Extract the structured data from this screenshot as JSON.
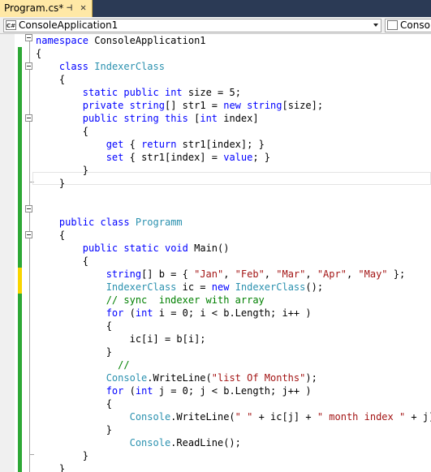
{
  "tab": {
    "title": "Program.cs*",
    "pin": "⊣",
    "close": "✕"
  },
  "nav": {
    "left_label": "ConsoleApplication1",
    "right_label": "Consol",
    "lang_icon": "C#"
  },
  "colors": {
    "keyword": "#0000ff",
    "type": "#2b91af",
    "string": "#a31515",
    "comment": "#008000",
    "tab_active": "#ffe8a6",
    "changed_saved": "#2ea836",
    "changed_unsaved": "#f9d500"
  },
  "code_lines": [
    [
      [
        "kw",
        "namespace"
      ],
      [
        "pl",
        " ConsoleApplication1"
      ]
    ],
    [
      [
        "pl",
        "{"
      ]
    ],
    [
      [
        "pl",
        "    "
      ],
      [
        "kw",
        "class"
      ],
      [
        "pl",
        " "
      ],
      [
        "ty",
        "IndexerClass"
      ]
    ],
    [
      [
        "pl",
        "    {"
      ]
    ],
    [
      [
        "pl",
        "        "
      ],
      [
        "kw",
        "static"
      ],
      [
        "pl",
        " "
      ],
      [
        "kw",
        "public"
      ],
      [
        "pl",
        " "
      ],
      [
        "kw",
        "int"
      ],
      [
        "pl",
        " size = 5;"
      ]
    ],
    [
      [
        "pl",
        "        "
      ],
      [
        "kw",
        "private"
      ],
      [
        "pl",
        " "
      ],
      [
        "kw",
        "string"
      ],
      [
        "pl",
        "[] str1 = "
      ],
      [
        "kw",
        "new"
      ],
      [
        "pl",
        " "
      ],
      [
        "kw",
        "string"
      ],
      [
        "pl",
        "[size];"
      ]
    ],
    [
      [
        "pl",
        "        "
      ],
      [
        "kw",
        "public"
      ],
      [
        "pl",
        " "
      ],
      [
        "kw",
        "string"
      ],
      [
        "pl",
        " "
      ],
      [
        "kw",
        "this"
      ],
      [
        "pl",
        " ["
      ],
      [
        "kw",
        "int"
      ],
      [
        "pl",
        " index]"
      ]
    ],
    [
      [
        "pl",
        "        {"
      ]
    ],
    [
      [
        "pl",
        "            "
      ],
      [
        "kw",
        "get"
      ],
      [
        "pl",
        " { "
      ],
      [
        "kw",
        "return"
      ],
      [
        "pl",
        " str1[index]; }"
      ]
    ],
    [
      [
        "pl",
        "            "
      ],
      [
        "kw",
        "set"
      ],
      [
        "pl",
        " { str1[index] = "
      ],
      [
        "kw",
        "value"
      ],
      [
        "pl",
        "; }"
      ]
    ],
    [
      [
        "pl",
        "        }"
      ]
    ],
    [
      [
        "pl",
        "    }"
      ]
    ],
    [
      [
        "pl",
        ""
      ]
    ],
    [
      [
        "pl",
        ""
      ]
    ],
    [
      [
        "pl",
        "    "
      ],
      [
        "kw",
        "public"
      ],
      [
        "pl",
        " "
      ],
      [
        "kw",
        "class"
      ],
      [
        "pl",
        " "
      ],
      [
        "ty",
        "Programm"
      ]
    ],
    [
      [
        "pl",
        "    {"
      ]
    ],
    [
      [
        "pl",
        "        "
      ],
      [
        "kw",
        "public"
      ],
      [
        "pl",
        " "
      ],
      [
        "kw",
        "static"
      ],
      [
        "pl",
        " "
      ],
      [
        "kw",
        "void"
      ],
      [
        "pl",
        " Main()"
      ]
    ],
    [
      [
        "pl",
        "        {"
      ]
    ],
    [
      [
        "pl",
        "            "
      ],
      [
        "kw",
        "string"
      ],
      [
        "pl",
        "[] b = { "
      ],
      [
        "st",
        "\"Jan\""
      ],
      [
        "pl",
        ", "
      ],
      [
        "st",
        "\"Feb\""
      ],
      [
        "pl",
        ", "
      ],
      [
        "st",
        "\"Mar\""
      ],
      [
        "pl",
        ", "
      ],
      [
        "st",
        "\"Apr\""
      ],
      [
        "pl",
        ", "
      ],
      [
        "st",
        "\"May\""
      ],
      [
        "pl",
        " };"
      ]
    ],
    [
      [
        "pl",
        "            "
      ],
      [
        "ty",
        "IndexerClass"
      ],
      [
        "pl",
        " ic = "
      ],
      [
        "kw",
        "new"
      ],
      [
        "pl",
        " "
      ],
      [
        "ty",
        "IndexerClass"
      ],
      [
        "pl",
        "();"
      ]
    ],
    [
      [
        "pl",
        "            "
      ],
      [
        "cm",
        "// sync  indexer with array"
      ]
    ],
    [
      [
        "pl",
        "            "
      ],
      [
        "kw",
        "for"
      ],
      [
        "pl",
        " ("
      ],
      [
        "kw",
        "int"
      ],
      [
        "pl",
        " i = 0; i < b.Length; i++ )"
      ]
    ],
    [
      [
        "pl",
        "            {"
      ]
    ],
    [
      [
        "pl",
        "                ic[i] = b[i];"
      ]
    ],
    [
      [
        "pl",
        "            }"
      ]
    ],
    [
      [
        "pl",
        "              "
      ],
      [
        "cm",
        "//"
      ]
    ],
    [
      [
        "pl",
        "            "
      ],
      [
        "ty",
        "Console"
      ],
      [
        "pl",
        ".WriteLine("
      ],
      [
        "st",
        "\"list Of Months\""
      ],
      [
        "pl",
        ");"
      ]
    ],
    [
      [
        "pl",
        "            "
      ],
      [
        "kw",
        "for"
      ],
      [
        "pl",
        " ("
      ],
      [
        "kw",
        "int"
      ],
      [
        "pl",
        " j = 0; j < b.Length; j++ )"
      ]
    ],
    [
      [
        "pl",
        "            {"
      ]
    ],
    [
      [
        "pl",
        "                "
      ],
      [
        "ty",
        "Console"
      ],
      [
        "pl",
        ".WriteLine("
      ],
      [
        "st",
        "\" \""
      ],
      [
        "pl",
        " + ic[j] + "
      ],
      [
        "st",
        "\" month index \""
      ],
      [
        "pl",
        " + j);"
      ]
    ],
    [
      [
        "pl",
        "            }"
      ]
    ],
    [
      [
        "pl",
        "                "
      ],
      [
        "ty",
        "Console"
      ],
      [
        "pl",
        ".ReadLine();"
      ]
    ],
    [
      [
        "pl",
        "        }"
      ]
    ],
    [
      [
        "pl",
        "    }"
      ]
    ],
    [
      [
        "pl",
        "}"
      ]
    ]
  ]
}
